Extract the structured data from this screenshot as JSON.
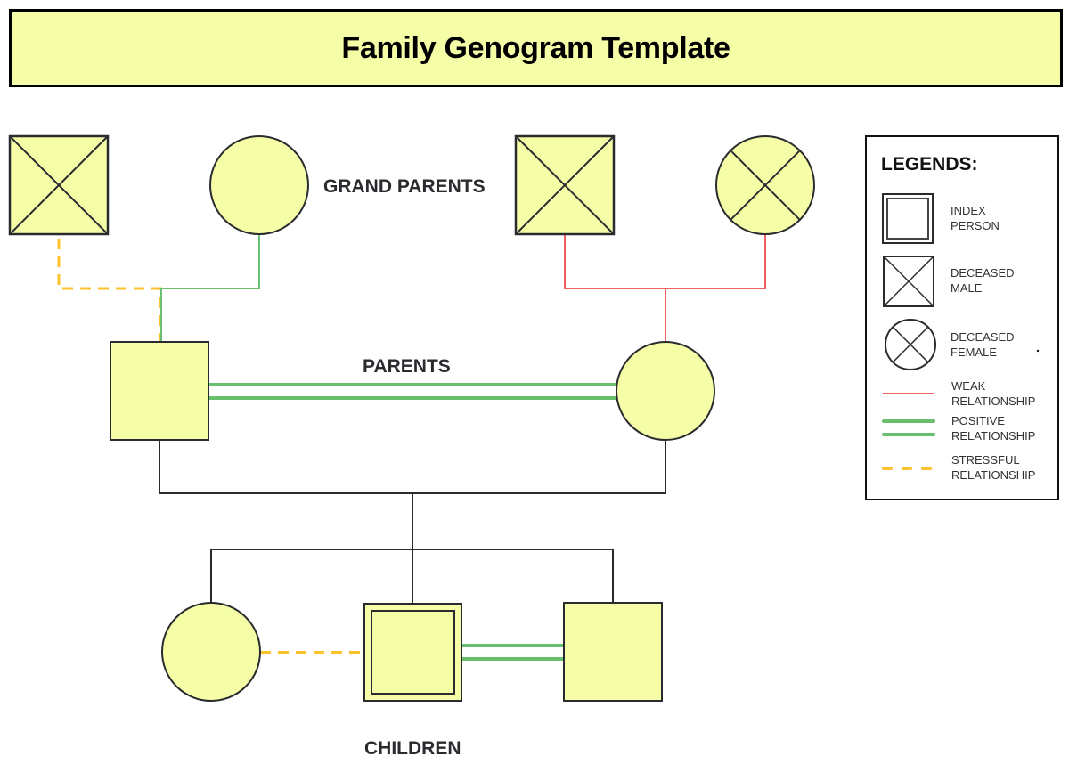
{
  "title": "Family Genogram Template",
  "colors": {
    "fill": "#f5fea6",
    "stroke": "#2a2b2f",
    "weak": "#f06262",
    "positive": "#6abf6e",
    "stressful": "#fcc22e"
  },
  "generations": {
    "grandparents": "GRAND PARENTS",
    "parents": "PARENTS",
    "children": "CHILDREN"
  },
  "people": [
    {
      "id": "paternal-grandfather",
      "generation": "grandparents",
      "sex": "male",
      "status": "deceased",
      "index": false
    },
    {
      "id": "paternal-grandmother",
      "generation": "grandparents",
      "sex": "female",
      "status": "living",
      "index": false
    },
    {
      "id": "maternal-grandfather",
      "generation": "grandparents",
      "sex": "male",
      "status": "deceased",
      "index": false
    },
    {
      "id": "maternal-grandmother",
      "generation": "grandparents",
      "sex": "female",
      "status": "deceased",
      "index": false
    },
    {
      "id": "father",
      "generation": "parents",
      "sex": "male",
      "status": "living",
      "index": false
    },
    {
      "id": "mother",
      "generation": "parents",
      "sex": "female",
      "status": "living",
      "index": false
    },
    {
      "id": "daughter",
      "generation": "children",
      "sex": "female",
      "status": "living",
      "index": false
    },
    {
      "id": "index-son",
      "generation": "children",
      "sex": "male",
      "status": "living",
      "index": true
    },
    {
      "id": "son",
      "generation": "children",
      "sex": "male",
      "status": "living",
      "index": false
    }
  ],
  "relationships": [
    {
      "from": "paternal-grandfather",
      "to": "father",
      "type": "stressful"
    },
    {
      "from": "paternal-grandmother",
      "to": "father",
      "type": "positive"
    },
    {
      "from": "maternal-grandfather",
      "to": "mother",
      "type": "weak"
    },
    {
      "from": "maternal-grandmother",
      "to": "mother",
      "type": "weak"
    },
    {
      "from": "father",
      "to": "mother",
      "type": "positive"
    },
    {
      "from": "daughter",
      "to": "index-son",
      "type": "stressful"
    },
    {
      "from": "index-son",
      "to": "son",
      "type": "positive"
    }
  ],
  "legend": {
    "title": "LEGENDS:",
    "items": [
      {
        "symbol": "index-person",
        "line1": "INDEX",
        "line2": "PERSON"
      },
      {
        "symbol": "deceased-male",
        "line1": "DECEASED",
        "line2": "MALE"
      },
      {
        "symbol": "deceased-female",
        "line1": "DECEASED",
        "line2": "FEMALE"
      },
      {
        "symbol": "weak-line",
        "line1": "WEAK",
        "line2": "RELATIONSHIP"
      },
      {
        "symbol": "positive-line",
        "line1": "POSITIVE",
        "line2": "RELATIONSHIP"
      },
      {
        "symbol": "stressful-line",
        "line1": "STRESSFUL",
        "line2": "RELATIONSHIP"
      }
    ]
  }
}
